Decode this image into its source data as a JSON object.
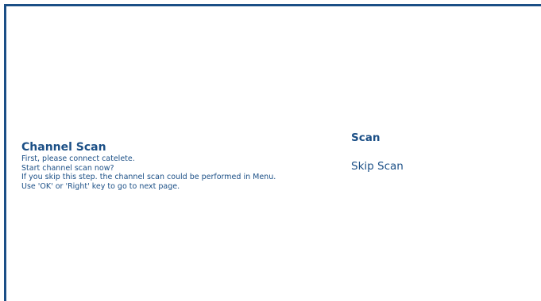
{
  "colors": {
    "accent": "#1b4f86",
    "background": "#ffffff"
  },
  "info": {
    "title": "Channel Scan",
    "lines": [
      "First, please connect catelete.",
      "Start channel scan now?",
      "If you skip this step. the channel scan could be performed in Menu.",
      "Use 'OK' or 'Right' key to go to next page."
    ]
  },
  "menu": {
    "selected_index": 0,
    "items": [
      {
        "label": "Scan"
      },
      {
        "label": "Skip Scan"
      }
    ]
  }
}
